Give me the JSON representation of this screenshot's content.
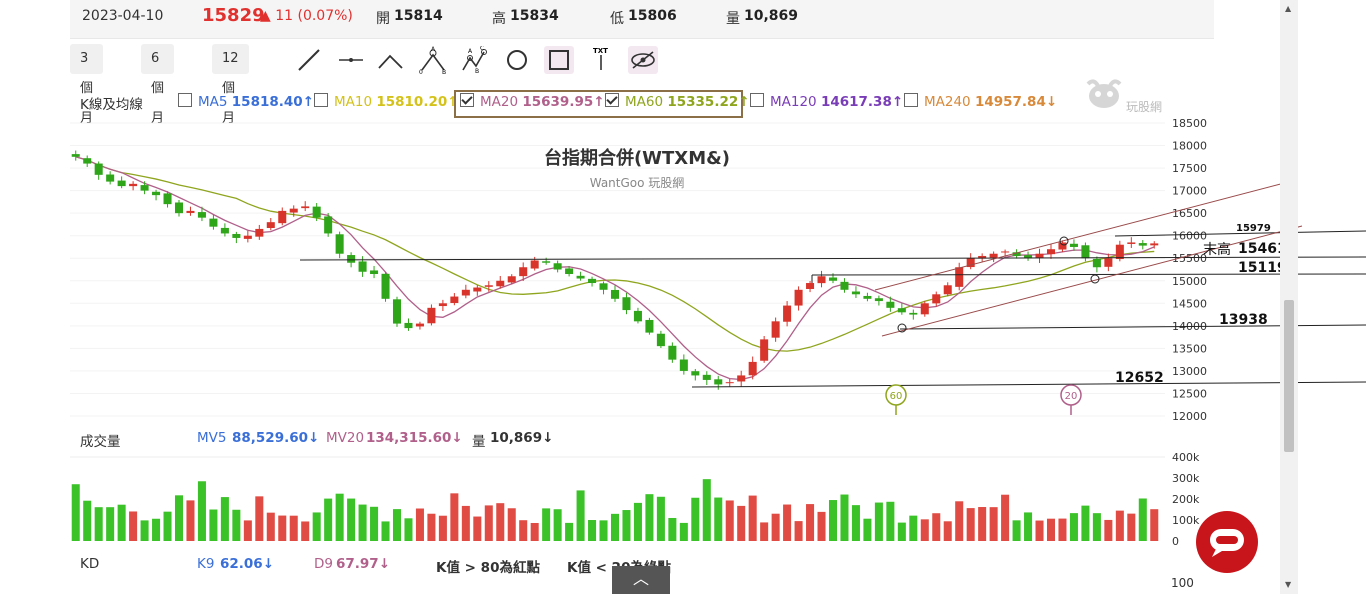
{
  "quote": {
    "date": "2023-04-10",
    "price": "15829",
    "change": "▲ 11 (0.07%)",
    "open_label": "開",
    "open": "15814",
    "high_label": "高",
    "high": "15834",
    "low_label": "低",
    "low": "15806",
    "vol_label": "量",
    "vol": "10,869"
  },
  "toolbar": {
    "ranges": [
      "3 個月",
      "6 個月",
      "12 個月"
    ],
    "tools": [
      "trendline-tool",
      "horizontal-line-tool",
      "angle-tool",
      "three-point-tool",
      "abcd-pattern-tool",
      "circle-tool",
      "rectangle-tool",
      "text-tool",
      "hide-drawings-tool"
    ]
  },
  "ma": {
    "title": "K線及均線",
    "items": [
      {
        "name": "MA5",
        "value": "15818.40↑",
        "checked": false,
        "color": "#3a6fd8"
      },
      {
        "name": "MA10",
        "value": "15810.20↑",
        "checked": false,
        "color": "#d4c21a"
      },
      {
        "name": "MA20",
        "value": "15639.95↑",
        "checked": true,
        "color": "#b0608a"
      },
      {
        "name": "MA60",
        "value": "15335.22↑",
        "checked": true,
        "color": "#8fa51e"
      },
      {
        "name": "MA120",
        "value": "14617.38↑",
        "checked": false,
        "color": "#7a3db8"
      },
      {
        "name": "MA240",
        "value": "14957.84↓",
        "checked": false,
        "color": "#d8893a"
      }
    ]
  },
  "logo_text": "玩股網",
  "chart_data": {
    "type": "candlestick",
    "title": "台指期合併(WTXM&)",
    "subtitle": "WantGoo 玩股網",
    "y_ticks": [
      "18500",
      "18000",
      "17500",
      "17000",
      "16500",
      "16000",
      "15500",
      "15000",
      "14500",
      "14000",
      "13500",
      "13000",
      "12500",
      "12000"
    ],
    "ylim": [
      12000,
      18500
    ],
    "annotations": [
      {
        "text": "15979"
      },
      {
        "text": "末高"
      },
      {
        "text": "15461"
      },
      {
        "text": "15119"
      },
      {
        "text": "13938"
      },
      {
        "text": "12652"
      }
    ],
    "markers": [
      "60",
      "20"
    ],
    "closes": [
      17750,
      17600,
      17350,
      17200,
      17100,
      17150,
      17000,
      16900,
      16700,
      16500,
      16550,
      16400,
      16200,
      16050,
      15950,
      16000,
      16150,
      16300,
      16550,
      16600,
      16650,
      16400,
      16050,
      15600,
      15400,
      15200,
      15150,
      14600,
      14050,
      13950,
      14050,
      14400,
      14500,
      14650,
      14800,
      14850,
      14900,
      15000,
      15100,
      15300,
      15450,
      15400,
      15250,
      15150,
      15050,
      14950,
      14800,
      14600,
      14350,
      14100,
      13850,
      13550,
      13250,
      13000,
      12900,
      12800,
      12700,
      12750,
      12900,
      13200,
      13700,
      14100,
      14450,
      14800,
      14950,
      15100,
      15000,
      14800,
      14700,
      14600,
      14550,
      14400,
      14300,
      14250,
      14500,
      14700,
      14900,
      15300,
      15500,
      15550,
      15600,
      15650,
      15550,
      15500,
      15600,
      15700,
      15850,
      15750,
      15500,
      15300,
      15500,
      15800,
      15850,
      15780,
      15829
    ],
    "volume_ticks": [
      "400k",
      "300k",
      "200k",
      "100k",
      "0"
    ]
  },
  "volume": {
    "title": "成交量",
    "mv5_label": "MV5",
    "mv5": "88,529.60↓",
    "mv20_label": "MV20",
    "mv20": "134,315.60↓",
    "vol_label": "量",
    "vol": "10,869↓"
  },
  "kd": {
    "title": "KD",
    "k_label": "K9",
    "k": "62.06↓",
    "d_label": "D9",
    "d": "67.97↓",
    "note1": "K值 > 80為紅點",
    "note2": "K值 < 20為綠點",
    "tick": "100"
  }
}
